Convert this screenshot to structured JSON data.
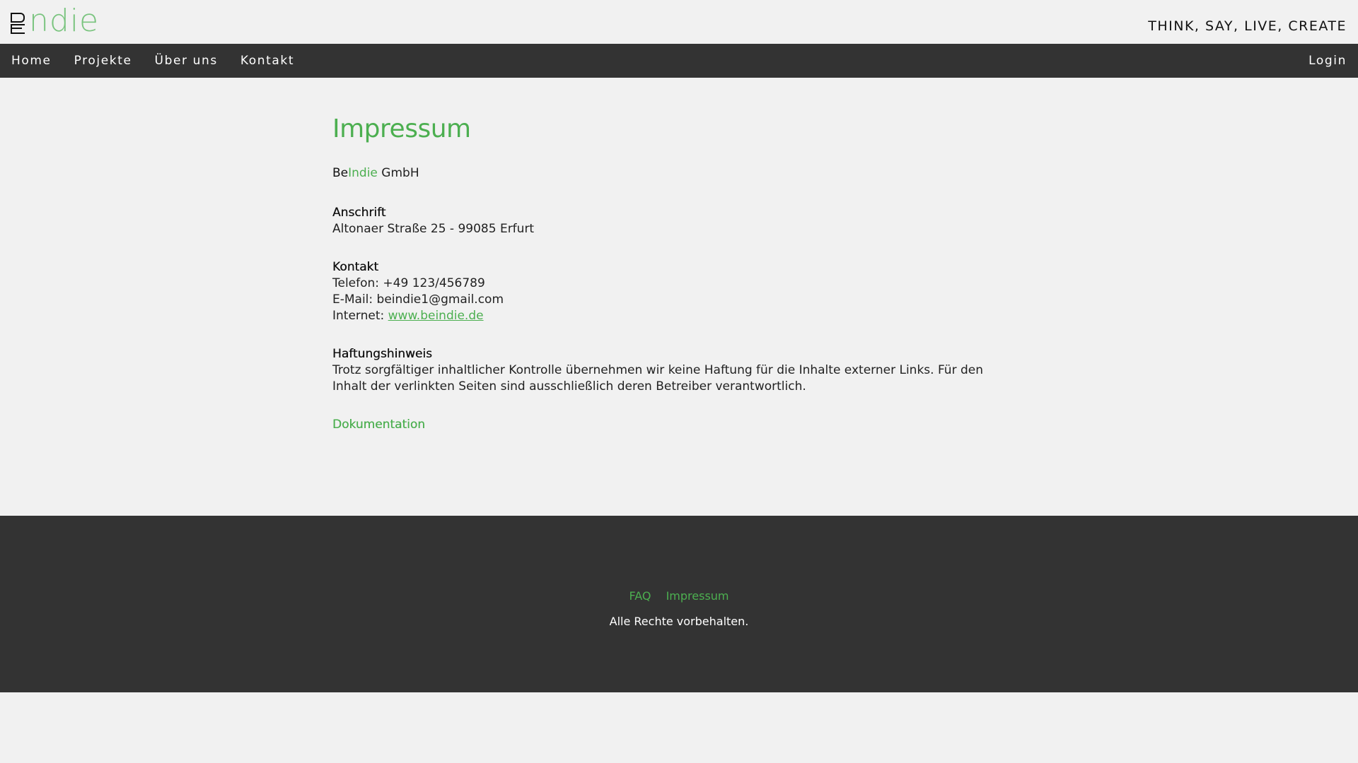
{
  "header": {
    "logo_text": "ndie",
    "logo_mark": "BE",
    "tagline": "THINK, SAY, LIVE, CREATE"
  },
  "nav": {
    "items": [
      {
        "label": "Home"
      },
      {
        "label": "Projekte"
      },
      {
        "label": "Über uns"
      },
      {
        "label": "Kontakt"
      }
    ],
    "login_label": "Login"
  },
  "main": {
    "title": "Impressum",
    "company": {
      "be": "Be",
      "indie": "Indie",
      "suffix": " GmbH"
    },
    "address": {
      "heading": "Anschrift",
      "line": "Altonaer Straße 25 - 99085 Erfurt"
    },
    "contact": {
      "heading": "Kontakt",
      "phone": "Telefon: +49 123/456789",
      "email": "E-Mail: beindie1@gmail.com",
      "internet_label": "Internet: ",
      "internet_link": "www.beindie.de"
    },
    "liability": {
      "heading": "Haftungshinweis",
      "text": "Trotz sorgfältiger inhaltlicher Kontrolle übernehmen wir keine Haftung für die Inhalte externer Links. Für den Inhalt der verlinkten Seiten sind ausschließlich deren Betreiber verantwortlich."
    },
    "documentation_link": "Dokumentation"
  },
  "footer": {
    "links": [
      {
        "label": "FAQ"
      },
      {
        "label": "Impressum"
      }
    ],
    "copyright": "Alle Rechte vorbehalten."
  },
  "colors": {
    "accent": "#4caf50",
    "dark_bar": "#333333",
    "background": "#f1f1f1"
  }
}
